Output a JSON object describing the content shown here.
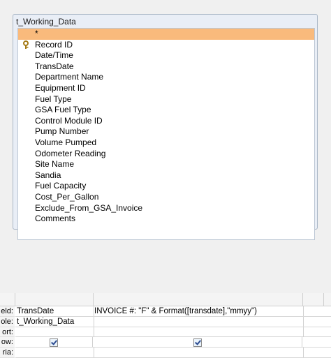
{
  "table_box": {
    "title": "t_Working_Data",
    "fields": [
      {
        "label": "*",
        "selected": true,
        "icon": ""
      },
      {
        "label": "Record ID",
        "selected": false,
        "icon": "primary-key-icon"
      },
      {
        "label": "Date/Time",
        "selected": false,
        "icon": ""
      },
      {
        "label": "TransDate",
        "selected": false,
        "icon": ""
      },
      {
        "label": "Department Name",
        "selected": false,
        "icon": ""
      },
      {
        "label": "Equipment ID",
        "selected": false,
        "icon": ""
      },
      {
        "label": "Fuel Type",
        "selected": false,
        "icon": ""
      },
      {
        "label": "GSA Fuel Type",
        "selected": false,
        "icon": ""
      },
      {
        "label": "Control Module ID",
        "selected": false,
        "icon": ""
      },
      {
        "label": "Pump Number",
        "selected": false,
        "icon": ""
      },
      {
        "label": "Volume Pumped",
        "selected": false,
        "icon": ""
      },
      {
        "label": "Odometer Reading",
        "selected": false,
        "icon": ""
      },
      {
        "label": "Site Name",
        "selected": false,
        "icon": ""
      },
      {
        "label": "Sandia",
        "selected": false,
        "icon": ""
      },
      {
        "label": "Fuel Capacity",
        "selected": false,
        "icon": ""
      },
      {
        "label": "Cost_Per_Gallon",
        "selected": false,
        "icon": ""
      },
      {
        "label": "Exclude_From_GSA_Invoice",
        "selected": false,
        "icon": ""
      },
      {
        "label": "Comments",
        "selected": false,
        "icon": ""
      }
    ],
    "selected_color": "#f9ba7c"
  },
  "query_grid": {
    "row_headers": [
      "eld:",
      "ole:",
      "ort:",
      "ow:",
      "ria:"
    ],
    "field": [
      "TransDate",
      "INVOICE #: \"F\" & Format([transdate],\"mmyy\")",
      ""
    ],
    "table": [
      "t_Working_Data",
      "",
      ""
    ],
    "sort": [
      "",
      "",
      ""
    ],
    "show": [
      true,
      true,
      false
    ],
    "criteria": [
      "",
      "",
      ""
    ]
  }
}
